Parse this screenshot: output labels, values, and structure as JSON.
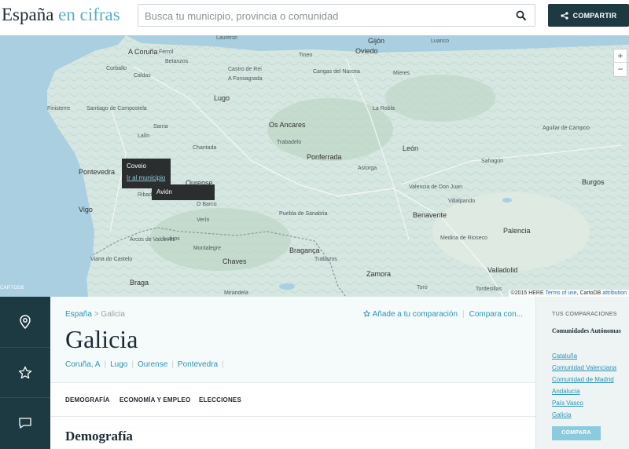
{
  "header": {
    "logo_main": "España",
    "logo_accent": "en cifras",
    "search_placeholder": "Busca tu municipio, provincia o comunidad",
    "share_label": "COMPARTIR"
  },
  "map": {
    "places": {
      "laurenzi": "Laurenzi",
      "a_coruna": "A Coruña",
      "betanzos": "Betanzos",
      "ferrol": "Ferrol",
      "corballo": "Corballo",
      "oviedo": "Oviedo",
      "gijon": "Gijón",
      "luanco": "Luanco",
      "castro": "Castro de Rei",
      "a_fonsagrada": "A Fonsagrada",
      "santiago": "Santiago de Compostela",
      "lugo": "Lugo",
      "os_ancares": "Os Ancares",
      "trabadelo": "Trabadelo",
      "ponferrada": "Ponferrada",
      "leon": "León",
      "astorga": "Astorga",
      "lalin": "Lalín",
      "chantada": "Chantada",
      "pontevedra": "Pontevedra",
      "vigo": "Vigo",
      "ourense": "Ourense",
      "finisterre": "Finisterre",
      "sarria": "Sarria",
      "ribadavia": "Ribadavia",
      "verin": "Verín",
      "chaves": "Chaves",
      "braganza": "Bragança",
      "braga": "Braga",
      "viana": "Viana do Castelo",
      "zamora": "Zamora",
      "valladolid": "Valladolid",
      "benavente": "Benavente",
      "mirandela": "Mirandela",
      "burgos": "Burgos",
      "palencia": "Palencia",
      "sahagun": "Sahagún",
      "toro": "Toro",
      "tordesillas": "Tordesillas",
      "medina": "Medina de Rioseco",
      "puebla": "Puebla de Sanabria",
      "trabazos": "Trabazos",
      "arcos": "Arcos de Valdevez",
      "montalegre": "Montalegre",
      "barco": "O Barco",
      "la_robla": "La Robla",
      "mieres": "Mieres",
      "aguilar": "Aguilar de Campoo",
      "cangas": "Cangas del Narcea",
      "tineo": "Tineo",
      "valencia": "Valencia de Don Juan",
      "villalpando": "Villalpando",
      "lubios": "Lubios",
      "caldas": "Caldas"
    },
    "zoom_in": "+",
    "zoom_out": "−",
    "tooltip1_title": "Coveio",
    "tooltip1_link": "Ir al municipio",
    "tooltip2_title": "Avión",
    "attribution_prefix": "©2015 HERE",
    "attribution_terms": "Terms of use",
    "attribution_carto": ", CartoDB",
    "attribution_link": "attribution",
    "cartodb_badge": "CARTODB"
  },
  "rail": {
    "location_icon": "location-pin-icon",
    "star_icon": "star-icon",
    "comment_icon": "comment-icon"
  },
  "main": {
    "breadcrumb_root": "España",
    "breadcrumb_sep": ">",
    "breadcrumb_current": "Galicia",
    "add_compare": "Añade a tu comparación",
    "compare_with": "Compara con...",
    "title": "Galicia",
    "provinces": [
      "Coruña, A",
      "Lugo",
      "Ourense",
      "Pontevedra"
    ],
    "tabs": [
      "DEMOGRAFÍA",
      "ECONOMÍA Y EMPLEO",
      "ELECCIONES"
    ],
    "section_title": "Demografía"
  },
  "compare_panel": {
    "heading": "TUS COMPARACIONES",
    "group": "Comunidades Autónomas",
    "items": [
      "Cataluña",
      "Comunidad Valenciana",
      "Comunidad de Madrid",
      "Andalucía",
      "País Vasco",
      "Galicia"
    ],
    "button": "COMPARA"
  },
  "colors": {
    "brand_dark": "#1d3a43",
    "accent": "#2b95b5",
    "logo_accent": "#5aaec2",
    "sea": "#a9cfe0",
    "land": "#cfe0dc"
  }
}
